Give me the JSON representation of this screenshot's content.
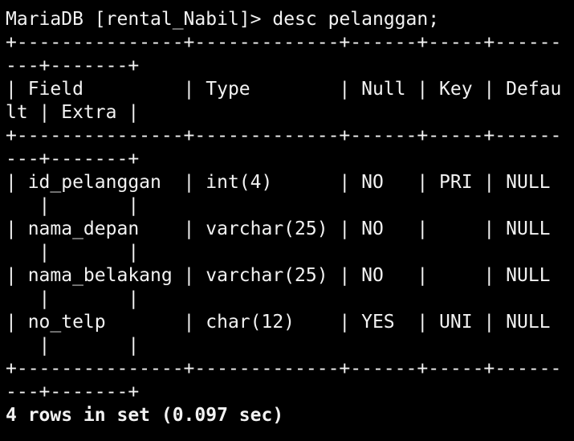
{
  "terminal": {
    "prompt": "MariaDB [rental_Nabil]> ",
    "command": "desc pelanggan;",
    "lines": [
      "+---------------+-------------+------+-----+------",
      "---+-------+",
      "| Field         | Type        | Null | Key | Defau",
      "lt | Extra |",
      "+---------------+-------------+------+-----+------",
      "---+-------+",
      "| id_pelanggan  | int(4)      | NO   | PRI | NULL",
      "   |       |",
      "| nama_depan    | varchar(25) | NO   |     | NULL",
      "   |       |",
      "| nama_belakang | varchar(25) | NO   |     | NULL",
      "   |       |",
      "| no_telp       | char(12)    | YES  | UNI | NULL",
      "   |       |",
      "+---------------+-------------+------+-----+------",
      "---+-------+"
    ],
    "summary": "4 rows in set (0.097 sec)"
  },
  "table": {
    "columns": [
      "Field",
      "Type",
      "Null",
      "Key",
      "Default",
      "Extra"
    ],
    "rows": [
      [
        "id_pelanggan",
        "int(4)",
        "NO",
        "PRI",
        "NULL",
        ""
      ],
      [
        "nama_depan",
        "varchar(25)",
        "NO",
        "",
        "NULL",
        ""
      ],
      [
        "nama_belakang",
        "varchar(25)",
        "NO",
        "",
        "NULL",
        ""
      ],
      [
        "no_telp",
        "char(12)",
        "YES",
        "UNI",
        "NULL",
        ""
      ]
    ]
  }
}
